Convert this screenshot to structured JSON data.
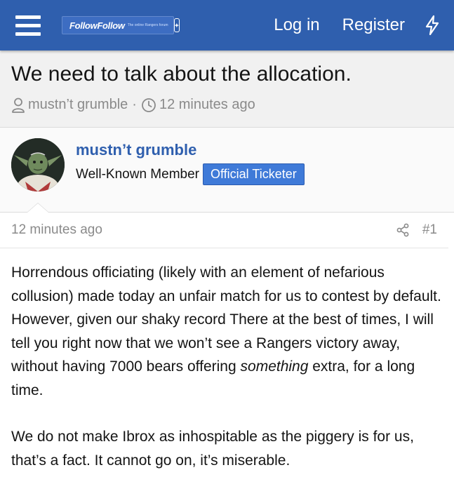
{
  "header": {
    "logo_text": "FollowFollow",
    "logo_subtext": "The online Rangers forum",
    "login_label": "Log in",
    "register_label": "Register"
  },
  "thread": {
    "title": "We need to talk about the allocation.",
    "author": "mustn’t grumble",
    "separator": "·",
    "time": "12 minutes ago"
  },
  "post": {
    "user_name": "mustn’t grumble",
    "user_title": "Well-Known Member",
    "badge": "Official Ticketer",
    "time": "12 minutes ago",
    "post_number": "#1",
    "paragraph1_part1": "Horrendous officiating (likely with an element of nefarious collusion) made today an unfair match for us to contest by default. However, given our shaky record There at the best of times, I will tell you right now that we won’t see a Rangers victory away, without having 7000 bears offering ",
    "paragraph1_emphasis": "something",
    "paragraph1_part2": " extra, for a long time.",
    "paragraph2": "We do not make Ibrox as inhospitable as the piggery is for us, that’s a fact. It cannot go on, it’s miserable."
  },
  "colors": {
    "header_bg": "#2f5fae",
    "link": "#2f5fae",
    "badge_bg": "#3f7ad8",
    "muted_text": "#8a8a8a"
  },
  "icons": {
    "menu": "hamburger-menu-icon",
    "whats_new": "lightning-bolt-icon",
    "author": "user-icon",
    "time": "clock-icon",
    "share": "share-icon"
  }
}
